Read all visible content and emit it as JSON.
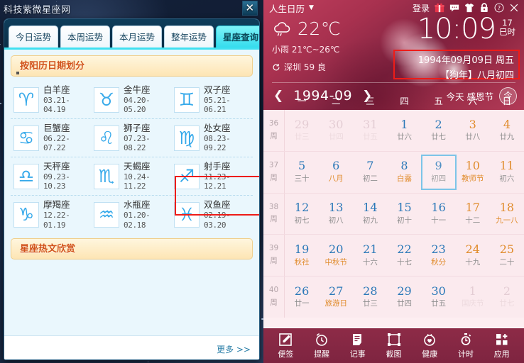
{
  "zodiac_app": {
    "window_title": "科技紫微星座网",
    "close_icon": "close-icon",
    "tabs": [
      {
        "label": "今日运势",
        "active": false
      },
      {
        "label": "本周运势",
        "active": false
      },
      {
        "label": "本月运势",
        "active": false
      },
      {
        "label": "整年运势",
        "active": false
      },
      {
        "label": "星座查询",
        "active": true
      }
    ],
    "section_title": "按阳历日期划分",
    "signs": [
      {
        "symbol": "♈",
        "name": "白羊座",
        "dates": "03.21-04.19",
        "highlighted": false
      },
      {
        "symbol": "♉",
        "name": "金牛座",
        "dates": "04.20-05.20",
        "highlighted": false
      },
      {
        "symbol": "♊",
        "name": "双子座",
        "dates": "05.21-06.21",
        "highlighted": false
      },
      {
        "symbol": "♋",
        "name": "巨蟹座",
        "dates": "06.22-07.22",
        "highlighted": false
      },
      {
        "symbol": "♌",
        "name": "狮子座",
        "dates": "07.23-08.22",
        "highlighted": false
      },
      {
        "symbol": "♍",
        "name": "处女座",
        "dates": "08.23-09.22",
        "highlighted": true
      },
      {
        "symbol": "♎",
        "name": "天秤座",
        "dates": "09.23-10.23",
        "highlighted": false
      },
      {
        "symbol": "♏",
        "name": "天蝎座",
        "dates": "10.24-11.22",
        "highlighted": false
      },
      {
        "symbol": "♐",
        "name": "射手座",
        "dates": "11.23-12.21",
        "highlighted": false
      },
      {
        "symbol": "♑",
        "name": "摩羯座",
        "dates": "12.22-01.19",
        "highlighted": false
      },
      {
        "symbol": "♒",
        "name": "水瓶座",
        "dates": "01.20-02.18",
        "highlighted": false
      },
      {
        "symbol": "♓",
        "name": "双鱼座",
        "dates": "02.19-03.20",
        "highlighted": false
      }
    ],
    "hot_title": "星座热文欣赏",
    "more_label": "更多 >>",
    "colors": {
      "active_tab": "#35dced",
      "section_text": "#d1521a",
      "icon_blue": "#36a9ea",
      "highlight_red": "#ee1c18"
    }
  },
  "calendar_app": {
    "app_name": "人生日历",
    "dropdown_icon": "chevron-down-icon",
    "login_label": "登录",
    "top_icons": [
      "gift-icon",
      "chat-icon",
      "tshirt-icon",
      "lock-icon",
      "help-icon",
      "close-icon"
    ],
    "weather": {
      "icon": "cloud-rain-icon",
      "temperature": "22℃",
      "description": "小雨 21℃~26℃",
      "refresh_icon": "refresh-icon",
      "city_line": "深圳 59 良"
    },
    "clock": {
      "time": "10:09",
      "hour_badge": "17",
      "shichen": "巳时"
    },
    "date_box": {
      "gregorian": "1994年09月09日 周五",
      "lunar": "【狗年】八月初四",
      "border_color": "#ee1c18"
    },
    "month_nav": {
      "prev_icon": "chevron-left-icon",
      "next_icon": "chevron-right-icon",
      "month_label": "1994-09",
      "today_text": "今天 感恩节",
      "today_button": "今"
    },
    "weekdays": [
      "一",
      "二",
      "三",
      "四",
      "五",
      "六",
      "日"
    ],
    "weeks": [
      {
        "no": "36",
        "no_sub": "周",
        "days": [
          {
            "num": "29",
            "sub": "廿三",
            "style": "c-mute",
            "sub_style": "",
            "selected": false
          },
          {
            "num": "30",
            "sub": "廿四",
            "style": "c-mute",
            "sub_style": "",
            "selected": false
          },
          {
            "num": "31",
            "sub": "廿五",
            "style": "c-mute",
            "sub_style": "",
            "selected": false
          },
          {
            "num": "1",
            "sub": "廿六",
            "style": "c-blue",
            "sub_style": "",
            "selected": false
          },
          {
            "num": "2",
            "sub": "廿七",
            "style": "c-blue",
            "sub_style": "",
            "selected": false
          },
          {
            "num": "3",
            "sub": "廿八",
            "style": "c-orange",
            "sub_style": "",
            "selected": false
          },
          {
            "num": "4",
            "sub": "廿九",
            "style": "c-orange",
            "sub_style": "",
            "selected": false
          }
        ]
      },
      {
        "no": "37",
        "no_sub": "周",
        "days": [
          {
            "num": "5",
            "sub": "三十",
            "style": "c-blue",
            "sub_style": "",
            "selected": false
          },
          {
            "num": "6",
            "sub": "八月",
            "style": "c-blue",
            "sub_style": "s-orange",
            "selected": false
          },
          {
            "num": "7",
            "sub": "初二",
            "style": "c-blue",
            "sub_style": "",
            "selected": false
          },
          {
            "num": "8",
            "sub": "白露",
            "style": "c-blue",
            "sub_style": "s-orange",
            "selected": false
          },
          {
            "num": "9",
            "sub": "初四",
            "style": "c-blue",
            "sub_style": "",
            "selected": true
          },
          {
            "num": "10",
            "sub": "教师节",
            "style": "c-orange",
            "sub_style": "s-orange",
            "selected": false
          },
          {
            "num": "11",
            "sub": "初六",
            "style": "c-orange",
            "sub_style": "",
            "selected": false
          }
        ]
      },
      {
        "no": "38",
        "no_sub": "周",
        "days": [
          {
            "num": "12",
            "sub": "初七",
            "style": "c-blue",
            "sub_style": "",
            "selected": false
          },
          {
            "num": "13",
            "sub": "初八",
            "style": "c-blue",
            "sub_style": "",
            "selected": false
          },
          {
            "num": "14",
            "sub": "初九",
            "style": "c-blue",
            "sub_style": "",
            "selected": false
          },
          {
            "num": "15",
            "sub": "初十",
            "style": "c-blue",
            "sub_style": "",
            "selected": false
          },
          {
            "num": "16",
            "sub": "十一",
            "style": "c-blue",
            "sub_style": "",
            "selected": false
          },
          {
            "num": "17",
            "sub": "十二",
            "style": "c-orange",
            "sub_style": "",
            "selected": false
          },
          {
            "num": "18",
            "sub": "九一八",
            "style": "c-orange",
            "sub_style": "s-orange",
            "selected": false
          }
        ]
      },
      {
        "no": "39",
        "no_sub": "周",
        "days": [
          {
            "num": "19",
            "sub": "秋社",
            "style": "c-blue",
            "sub_style": "s-orange",
            "selected": false
          },
          {
            "num": "20",
            "sub": "中秋节",
            "style": "c-blue",
            "sub_style": "s-orange",
            "selected": false
          },
          {
            "num": "21",
            "sub": "十六",
            "style": "c-blue",
            "sub_style": "",
            "selected": false
          },
          {
            "num": "22",
            "sub": "十七",
            "style": "c-blue",
            "sub_style": "",
            "selected": false
          },
          {
            "num": "23",
            "sub": "秋分",
            "style": "c-blue",
            "sub_style": "s-orange",
            "selected": false
          },
          {
            "num": "24",
            "sub": "十九",
            "style": "c-orange",
            "sub_style": "",
            "selected": false
          },
          {
            "num": "25",
            "sub": "二十",
            "style": "c-orange",
            "sub_style": "",
            "selected": false
          }
        ]
      },
      {
        "no": "40",
        "no_sub": "周",
        "days": [
          {
            "num": "26",
            "sub": "廿一",
            "style": "c-blue",
            "sub_style": "",
            "selected": false
          },
          {
            "num": "27",
            "sub": "旅游日",
            "style": "c-blue",
            "sub_style": "s-orange",
            "selected": false
          },
          {
            "num": "28",
            "sub": "廿三",
            "style": "c-blue",
            "sub_style": "",
            "selected": false
          },
          {
            "num": "29",
            "sub": "廿四",
            "style": "c-blue",
            "sub_style": "",
            "selected": false
          },
          {
            "num": "30",
            "sub": "廿五",
            "style": "c-blue",
            "sub_style": "",
            "selected": false
          },
          {
            "num": "1",
            "sub": "国庆节",
            "style": "c-mute",
            "sub_style": "",
            "selected": false
          },
          {
            "num": "2",
            "sub": "廿七",
            "style": "c-mute",
            "sub_style": "",
            "selected": false
          }
        ]
      }
    ],
    "toolbar": [
      {
        "icon": "note-pencil-icon",
        "label": "便签"
      },
      {
        "icon": "alarm-clock-icon",
        "label": "提醒"
      },
      {
        "icon": "journal-icon",
        "label": "记事"
      },
      {
        "icon": "screenshot-icon",
        "label": "截图"
      },
      {
        "icon": "health-heart-icon",
        "label": "健康"
      },
      {
        "icon": "stopwatch-icon",
        "label": "计时"
      },
      {
        "icon": "apps-grid-icon",
        "label": "应用"
      }
    ]
  }
}
